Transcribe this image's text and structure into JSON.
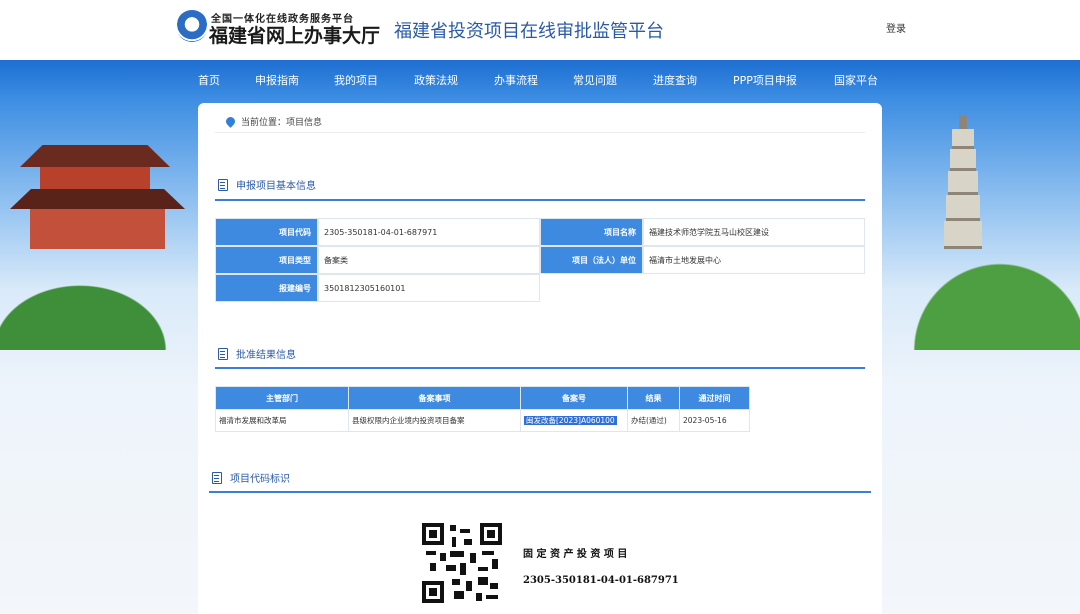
{
  "header": {
    "logo_top": "全国一体化在线政务服务平台",
    "logo_main": "福建省网上办事大厅",
    "platform_title": "福建省投资项目在线审批监管平台",
    "login": "登录"
  },
  "nav": [
    "首页",
    "申报指南",
    "我的项目",
    "政策法规",
    "办事流程",
    "常见问题",
    "进度查询",
    "PPP项目申报",
    "国家平台"
  ],
  "breadcrumb": "当前位置：项目信息",
  "basic_info": {
    "title": "申报项目基本信息",
    "code_label": "项目代码",
    "code_value": "2305-350181-04-01-687971",
    "name_label": "项目名称",
    "name_value": "福建技术师范学院五马山校区建设",
    "type_label": "项目类型",
    "type_value": "备案类",
    "unit_label": "项目（法人）单位",
    "unit_value": "福清市土地发展中心",
    "report_label": "报建编号",
    "report_value": "3501812305160101"
  },
  "approval": {
    "title": "批准结果信息",
    "headers": [
      "主管部门",
      "备案事项",
      "备案号",
      "结果",
      "通过时间"
    ],
    "row": {
      "dept": "福清市发展和改革局",
      "matter": "县级权限内企业境内投资项目备案",
      "number": "闽发改备[2023]A060100",
      "result": "办结(通过)",
      "date": "2023-05-16"
    }
  },
  "code_id": {
    "title": "项目代码标识",
    "caption_title": "固 定 资 产 投 资 项 目",
    "caption_code": "2305-350181-04-01-687971"
  }
}
